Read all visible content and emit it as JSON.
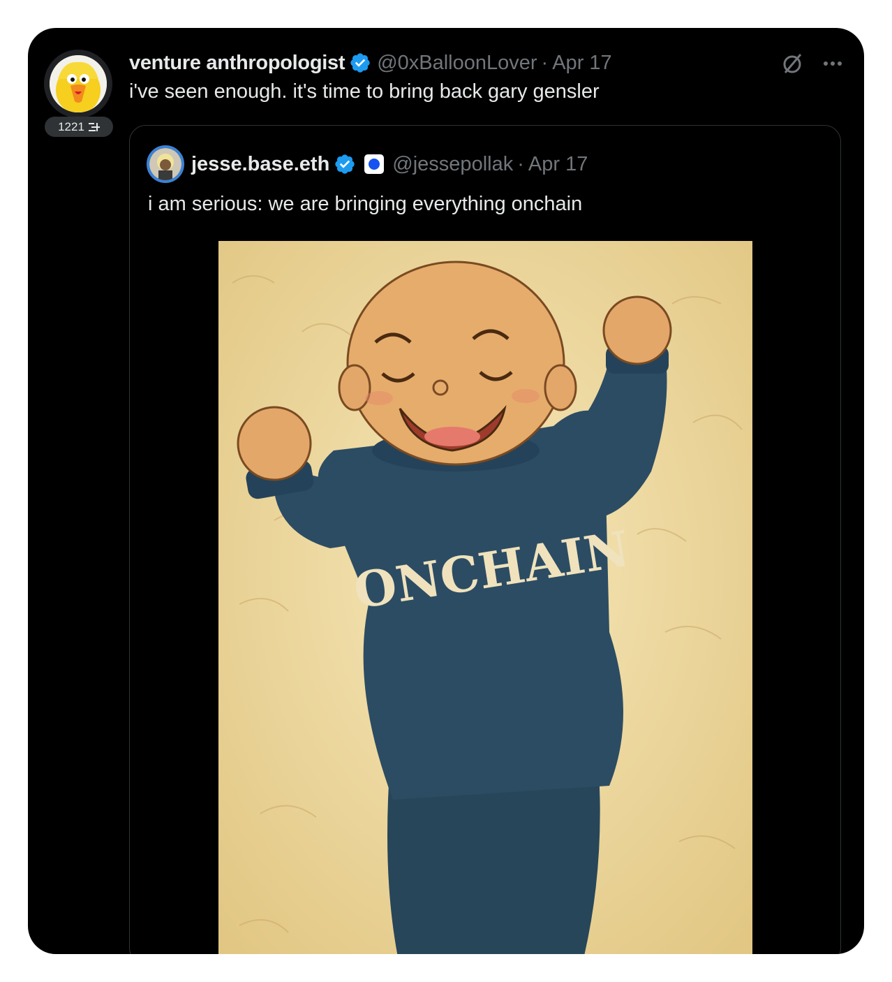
{
  "tweet": {
    "author_name": "venture anthropologist",
    "handle": "@0xBalloonLover",
    "separator": "·",
    "date": "Apr 17",
    "text": "i've seen enough. it's time to bring back gary gensler",
    "badge_count": "1221",
    "avatar": "big-bird-avatar",
    "icons": [
      "verified-badge-icon",
      "grok-icon",
      "more-icon",
      "thread-icon"
    ]
  },
  "quote": {
    "author_name": "jesse.base.eth",
    "handle": "@jessepollak",
    "separator": "·",
    "date": "Apr 17",
    "text": "i am serious: we are bringing everything onchain",
    "media": {
      "description_text": "ONCHAIN"
    }
  },
  "colors": {
    "background": "#000000",
    "primary_text": "#e7e9ea",
    "secondary_text": "#71767b",
    "verified": "#1d9bf0",
    "border": "#2f3336",
    "base_blue": "#1652f0"
  }
}
